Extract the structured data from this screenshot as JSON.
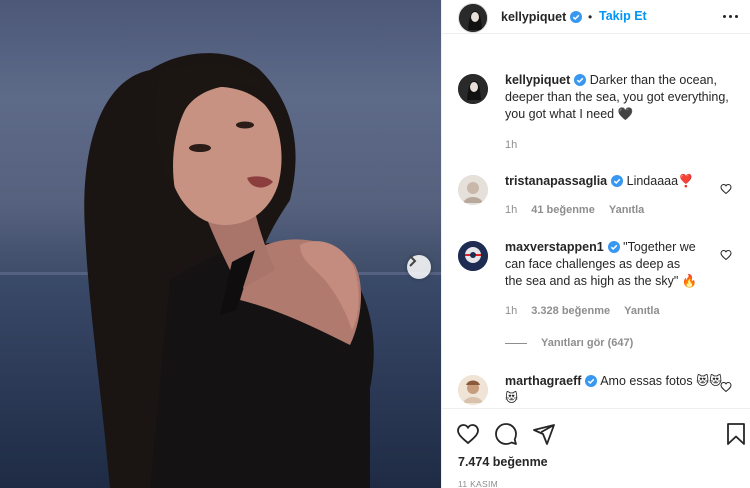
{
  "post": {
    "author": "kellypiquet",
    "follow_label": "Takip Et",
    "separator": "•",
    "caption": "Darker than the ocean, deeper than the sea, you got everything, you got what I need 🖤",
    "caption_time": "1h",
    "likes": "7.474 beğenme",
    "date": "11 KASIM"
  },
  "comments": [
    {
      "user": "tristanapassaglia",
      "text": "Lindaaaa❣️",
      "time": "1h",
      "likes": "41 beğenme",
      "reply": "Yanıtla"
    },
    {
      "user": "maxverstappen1",
      "text": "\"Together we can face challenges as deep as the sea and as high as the sky\" 🔥",
      "time": "1h",
      "likes": "3.328 beğenme",
      "reply": "Yanıtla",
      "view_replies": "Yanıtları gör (647)"
    },
    {
      "user": "marthagraeff",
      "text": "Amo essas fotos 😻😻😻"
    }
  ],
  "icons": {
    "verified": "verified-badge-icon",
    "heart": "heart-icon",
    "comment": "comment-icon",
    "share": "share-icon",
    "save": "bookmark-icon",
    "next": "chevron-right-icon",
    "more": "more-options-icon"
  },
  "colors": {
    "link": "#0095f6",
    "verified": "#3897f0",
    "text": "#262626",
    "muted": "#8e8e8e"
  }
}
